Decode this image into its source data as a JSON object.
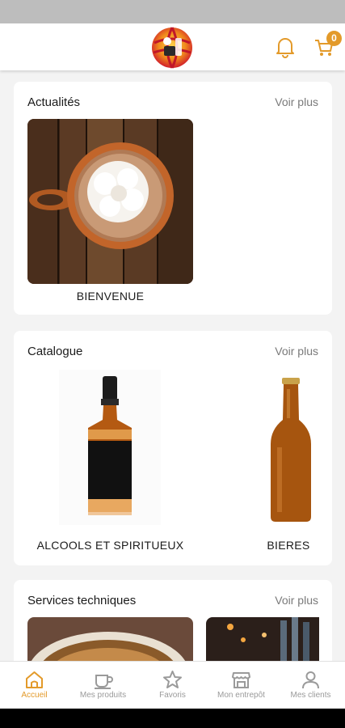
{
  "colors": {
    "accent": "#e39a2a",
    "text": "#1b1b1b",
    "muted": "#7a7a7a",
    "background": "#f3f3f3"
  },
  "header": {
    "logo_icon": "globe-logo-icon",
    "bell_icon": "bell-icon",
    "cart_icon": "cart-icon",
    "cart_count": "0"
  },
  "sections": {
    "news": {
      "title": "Actualités",
      "more": "Voir plus",
      "items": [
        {
          "label": "BIENVENUE",
          "image": "coffee-cup-image"
        }
      ]
    },
    "catalog": {
      "title": "Catalogue",
      "more": "Voir plus",
      "items": [
        {
          "label": "ALCOOLS ET SPIRITUEUX",
          "image": "whiskey-bottle-image"
        },
        {
          "label": "BIERES",
          "image": "beer-bottle-image"
        }
      ]
    },
    "services": {
      "title": "Services techniques",
      "more": "Voir plus",
      "items": [
        {
          "image": "coffee-image"
        },
        {
          "image": "bar-taps-image"
        }
      ]
    }
  },
  "nav": {
    "items": [
      {
        "label": "Accueil",
        "icon": "home-icon",
        "active": true
      },
      {
        "label": "Mes produits",
        "icon": "cup-icon",
        "active": false
      },
      {
        "label": "Favoris",
        "icon": "star-icon",
        "active": false
      },
      {
        "label": "Mon entrepôt",
        "icon": "store-icon",
        "active": false
      },
      {
        "label": "Mes clients",
        "icon": "user-icon",
        "active": false
      }
    ]
  }
}
